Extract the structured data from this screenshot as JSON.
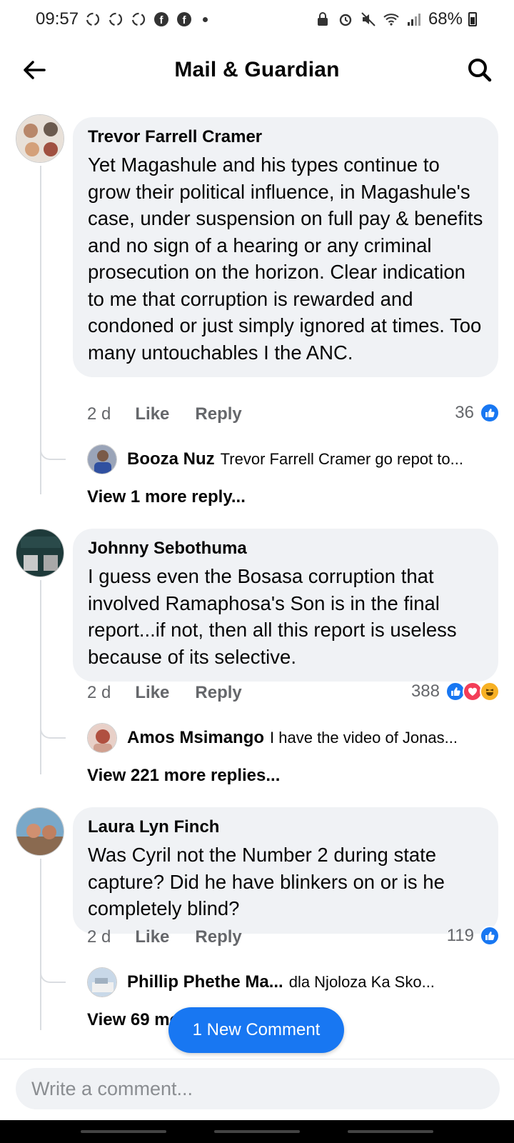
{
  "status_bar": {
    "time": "09:57",
    "battery": "68%"
  },
  "header": {
    "title": "Mail & Guardian",
    "back_icon": "arrow-left-icon",
    "search_icon": "search-icon"
  },
  "comments": [
    {
      "author": "Trevor Farrell Cramer",
      "text": "Yet Magashule and his types continue to grow their political influence, in Magashule's case,  under suspension on full pay & benefits and no sign of a hearing or any criminal prosecution on the horizon. Clear indication to me that corruption is rewarded and condoned or just simply ignored at times. Too many untouchables I the ANC.",
      "time": "2 d",
      "like_label": "Like",
      "reply_label": "Reply",
      "reaction_count": "36",
      "reactions": [
        "like"
      ],
      "reply_preview": {
        "name": "Booza Nuz",
        "text": "Trevor Farrell Cramer go repot to..."
      },
      "view_more": "View 1 more reply..."
    },
    {
      "author": "Johnny Sebothuma",
      "text": "I guess even the Bosasa corruption that involved Ramaphosa's Son is in the final report...if not, then all this report is useless because of its selective.",
      "time": "2 d",
      "like_label": "Like",
      "reply_label": "Reply",
      "reaction_count": "388",
      "reactions": [
        "like",
        "love",
        "haha"
      ],
      "reply_preview": {
        "name": "Amos Msimango",
        "text": "I have the video of Jonas..."
      },
      "view_more": "View 221 more replies..."
    },
    {
      "author": "Laura Lyn Finch",
      "text": "Was Cyril not the Number 2 during state capture? Did he have blinkers on or is he completely blind?",
      "time": "2 d",
      "like_label": "Like",
      "reply_label": "Reply",
      "reaction_count": "119",
      "reactions": [
        "like"
      ],
      "reply_preview": {
        "name": "Phillip Phethe Ma...",
        "text": "dla Njoloza Ka Sko..."
      },
      "view_more": "View 69 more replies..."
    }
  ],
  "new_comment_pill": "1 New Comment",
  "composer": {
    "placeholder": "Write a comment..."
  }
}
